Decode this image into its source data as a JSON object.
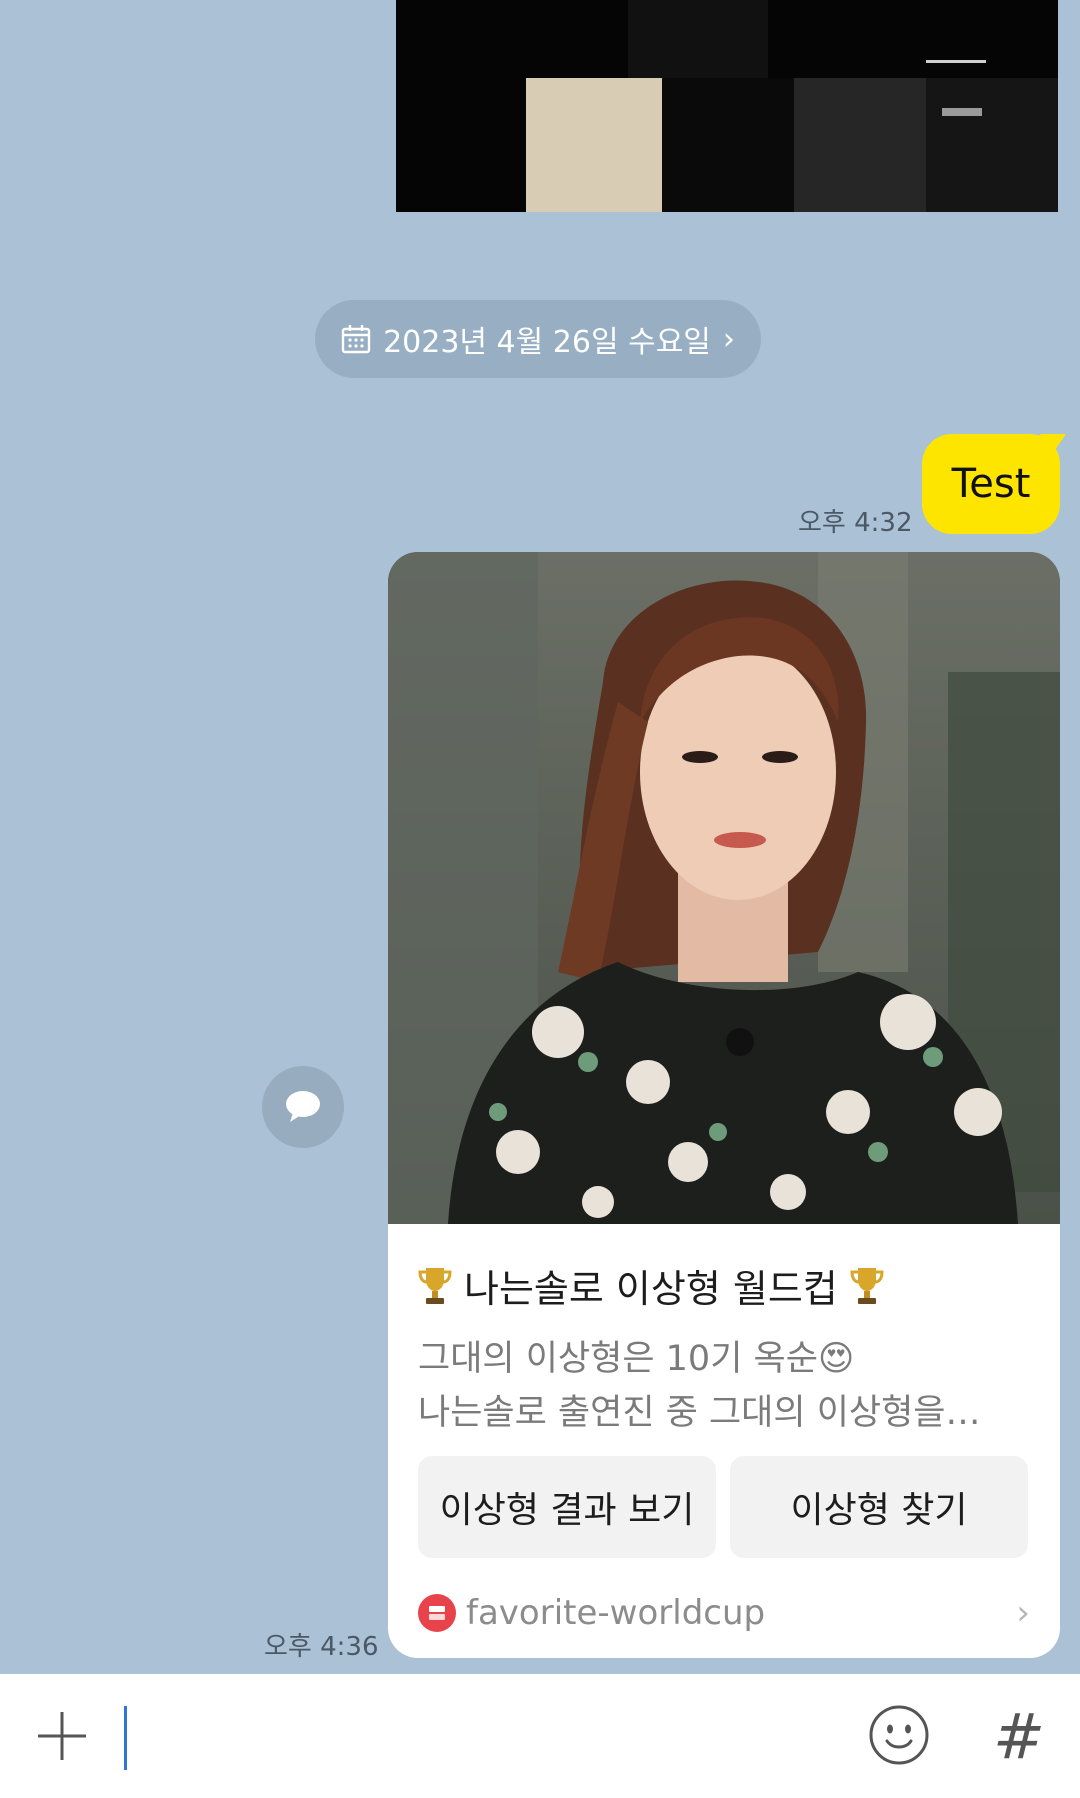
{
  "chat": {
    "date_divider": "2023년 4월 26일 수요일",
    "date_chevron": "›",
    "messages": [
      {
        "type": "text",
        "text": "Test",
        "time": "오후 4:32"
      },
      {
        "type": "card",
        "time": "오후 4:36"
      }
    ]
  },
  "card": {
    "title_icon": "trophy-icon",
    "title": "나는솔로 이상형 월드컵",
    "desc_line1": "그대의 이상형은 10기 옥순",
    "desc_emoji": "😍",
    "desc_line2": "나는솔로 출연진 중 그대의 이상형을…",
    "buttons": [
      {
        "label": "이상형 결과 보기"
      },
      {
        "label": "이상형 찾기"
      }
    ],
    "source": "favorite-worldcup",
    "source_chevron": "›"
  },
  "input_bar": {
    "hash_label": "#"
  },
  "colors": {
    "background": "#abc1d6",
    "my_bubble": "#fee500",
    "date_pill": "#97aec3",
    "caret": "#2f74d6"
  }
}
